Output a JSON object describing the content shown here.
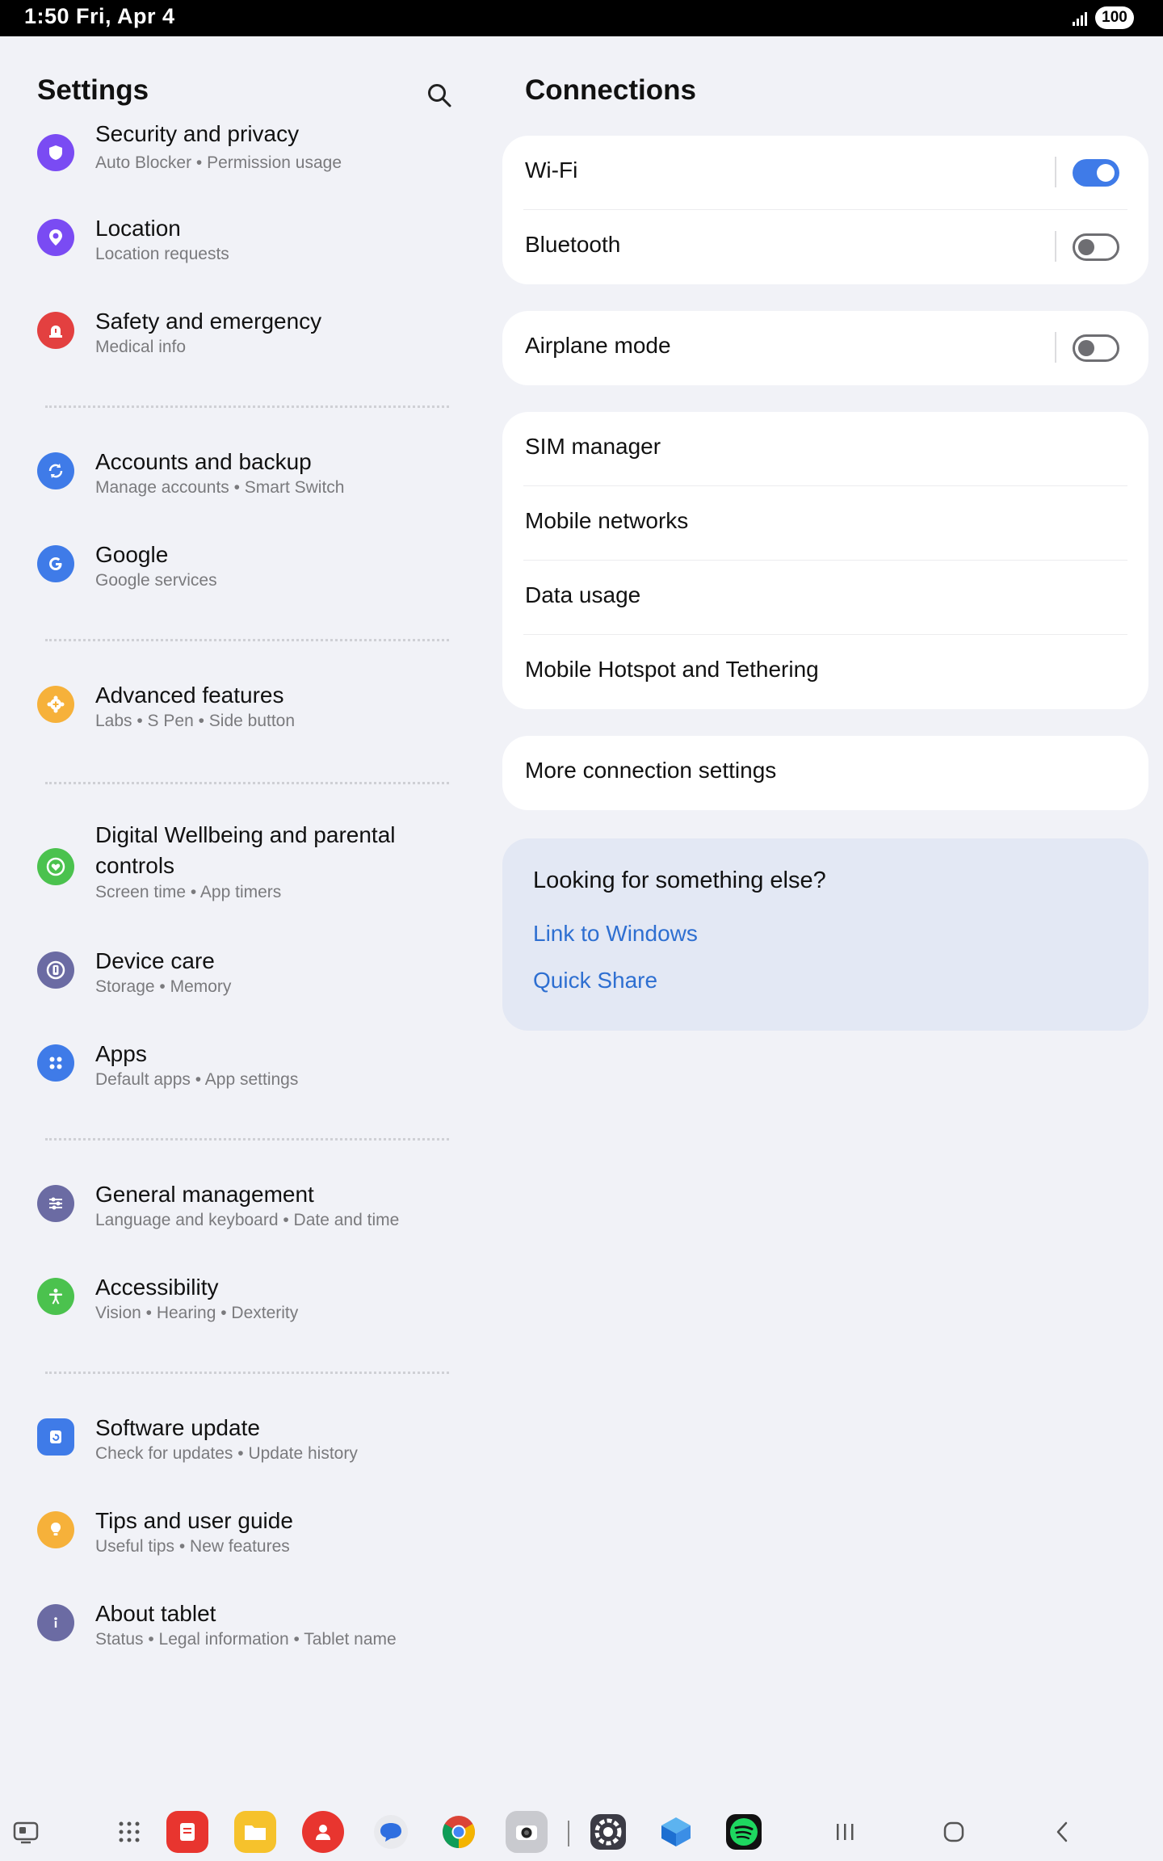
{
  "status_bar": {
    "time": "1:50  Fri, Apr 4",
    "battery": "100"
  },
  "left": {
    "title": "Settings",
    "items": [
      {
        "title": "Security and privacy",
        "subtitle": "Auto Blocker  •  Permission usage",
        "icon": "shield-icon",
        "color": "#7a4bf3"
      },
      {
        "title": "Location",
        "subtitle": "Location requests",
        "icon": "location-pin-icon",
        "color": "#7a4bf3"
      },
      {
        "title": "Safety and emergency",
        "subtitle": "Medical info",
        "icon": "siren-icon",
        "color": "#e34040"
      },
      {
        "title": "Accounts and backup",
        "subtitle": "Manage accounts  •  Smart Switch",
        "icon": "sync-icon",
        "color": "#3f7be8"
      },
      {
        "title": "Google",
        "subtitle": "Google services",
        "icon": "google-icon",
        "color": "#3f7be8"
      },
      {
        "title": "Advanced features",
        "subtitle": "Labs  •  S Pen  •  Side button",
        "icon": "gear-plus-icon",
        "color": "#f6b13a"
      },
      {
        "title": "Digital Wellbeing and parental",
        "title2": "controls",
        "subtitle": "Screen time  •  App timers",
        "icon": "heart-circle-icon",
        "color": "#4bc24e"
      },
      {
        "title": "Device care",
        "subtitle": "Storage  •  Memory",
        "icon": "device-care-icon",
        "color": "#6b6ba3"
      },
      {
        "title": "Apps",
        "subtitle": "Default apps  •  App settings",
        "icon": "apps-grid-icon",
        "color": "#3f7be8"
      },
      {
        "title": "General management",
        "subtitle": "Language and keyboard  •  Date and time",
        "icon": "sliders-icon",
        "color": "#6b6ba3"
      },
      {
        "title": "Accessibility",
        "subtitle": "Vision  •  Hearing  •  Dexterity",
        "icon": "accessibility-icon",
        "color": "#4bc24e"
      },
      {
        "title": "Software update",
        "subtitle": "Check for updates  •  Update history",
        "icon": "software-update-icon",
        "color": "#3f7be8"
      },
      {
        "title": "Tips and user guide",
        "subtitle": "Useful tips  •  New features",
        "icon": "lightbulb-icon",
        "color": "#f6b13a"
      },
      {
        "title": "About tablet",
        "subtitle": "Status  •  Legal information  •  Tablet name",
        "icon": "info-icon",
        "color": "#6b6ba3"
      }
    ]
  },
  "right": {
    "title": "Connections",
    "wifi": {
      "label": "Wi-Fi",
      "on": true
    },
    "bluetooth": {
      "label": "Bluetooth",
      "on": false
    },
    "airplane": {
      "label": "Airplane mode",
      "on": false
    },
    "sim_manager": "SIM manager",
    "mobile_networks": "Mobile networks",
    "data_usage": "Data usage",
    "hotspot": "Mobile Hotspot and Tethering",
    "more": "More connection settings",
    "suggest": {
      "question": "Looking for something else?",
      "links": [
        "Link to Windows",
        "Quick Share"
      ]
    }
  },
  "taskbar": {
    "apps": [
      "taskbar-toggle-icon",
      "app-drawer-icon",
      "samsung-notes-icon",
      "my-files-icon",
      "contacts-icon",
      "messages-icon",
      "chrome-icon",
      "camera-icon",
      "settings-app-icon",
      "microsoft-launcher-icon",
      "spotify-icon"
    ],
    "nav": [
      "recents-button",
      "home-button",
      "back-button"
    ]
  }
}
